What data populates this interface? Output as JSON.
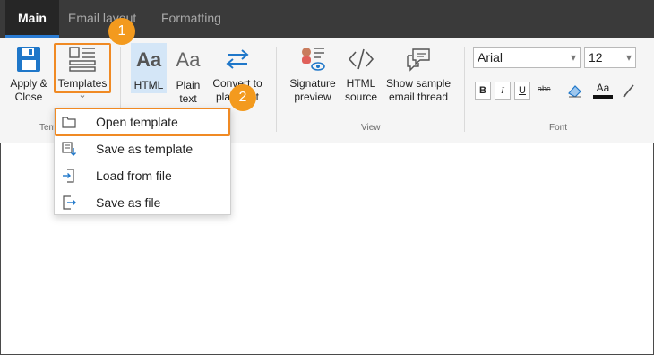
{
  "tabs": [
    {
      "label": "Main"
    },
    {
      "label": "Email layout"
    },
    {
      "label": "Formatting"
    }
  ],
  "ribbon": {
    "apply_close": {
      "line1": "Apply &",
      "line2": "Close"
    },
    "templates": {
      "label": "Templates",
      "chevron": "⌄"
    },
    "html": {
      "label": "HTML",
      "glyph": "Aa"
    },
    "plain_text": {
      "line1": "Plain",
      "line2": "text",
      "glyph": "Aa"
    },
    "convert": {
      "line1": "Convert to",
      "line2": "plain text"
    },
    "signature_preview": {
      "line1": "Signature",
      "line2": "preview"
    },
    "html_source": {
      "line1": "HTML",
      "line2": "source"
    },
    "show_sample": {
      "line1": "Show sample",
      "line2": "email thread"
    },
    "groups": {
      "templates": "Templates",
      "view": "View",
      "font": "Font"
    },
    "font": {
      "family": "Arial",
      "size": "12",
      "bold": "B",
      "italic": "I",
      "underline": "U",
      "strike": "abc",
      "font_color": "Aa"
    }
  },
  "templates_menu": {
    "items": [
      {
        "label": "Open template",
        "icon": "folder-icon"
      },
      {
        "label": "Save as template",
        "icon": "save-template-icon"
      },
      {
        "label": "Load from file",
        "icon": "load-file-icon"
      },
      {
        "label": "Save as file",
        "icon": "save-file-icon"
      }
    ]
  },
  "callouts": {
    "step1": "1",
    "step2": "2"
  },
  "colors": {
    "accent": "#2b7cd3",
    "callout": "#f39a1e",
    "highlight_border": "#f08a24",
    "tabbar": "#3a3a3a"
  }
}
